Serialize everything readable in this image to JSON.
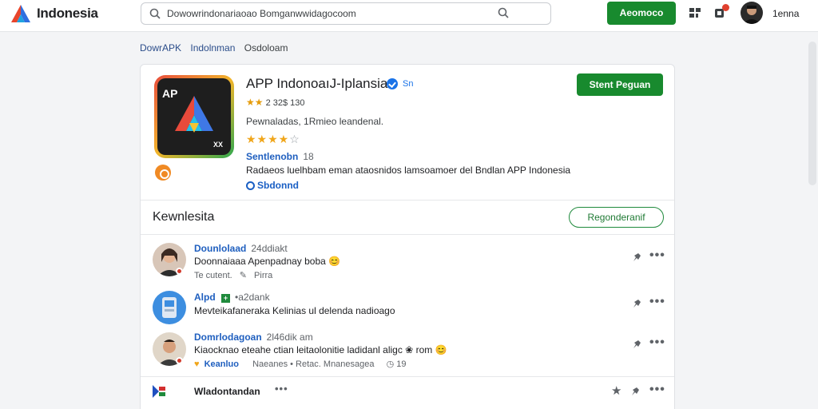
{
  "header": {
    "brand": "Indonesia",
    "search_value": "Dowowrindonariaoao Bomganwwidagocoom",
    "action_button": "Aeomoco",
    "username": "1enna"
  },
  "breadcrumb": [
    "DowrAPK",
    "Indolnman",
    "Osdoloam"
  ],
  "app": {
    "title": "APP IndonoaıJ-Iplansia",
    "verified_label": "Sn",
    "rating": "2  32$  130",
    "downloads": "Pewnaladas, 1Rmieo leandenal.",
    "developer": "Sentlenobn",
    "developer_count": "18",
    "description": "Radaeos luelhbam eman ataosnidos lamsoamoer del Bndlan APP Indonesia",
    "link": "Sbdonnd",
    "primary_button": "Stent Peguan",
    "stars_rating": 4
  },
  "section": {
    "title": "Kewnlesita",
    "button": "Regonderanif"
  },
  "comments": [
    {
      "author": "Dounlolaad",
      "meta": "24ddiakt",
      "text": "Doonnaiaaa Apenpadnay boba 😊",
      "sub_a": "Te cutent.",
      "sub_b": "Pirra"
    },
    {
      "author": "Alpd",
      "meta": "•a2dank",
      "text": "Mevteikafaneraka Kelinias ul delenda nadioago"
    },
    {
      "author": "Domrlodagoan",
      "meta": "2l46dik am",
      "text": "Kiaocknao eteahe ctian leitaolonitie ladidanl aligc ❀ rom 😊",
      "sub_a": "Keanluo",
      "sub_b": "Naeanes • Retac. Mnanesagea",
      "sub_c": "19"
    }
  ],
  "last_item": {
    "title": "Wladontandan"
  },
  "colors": {
    "accent": "#188a2e",
    "link": "#1f5fbf",
    "star": "#f0a61b"
  }
}
